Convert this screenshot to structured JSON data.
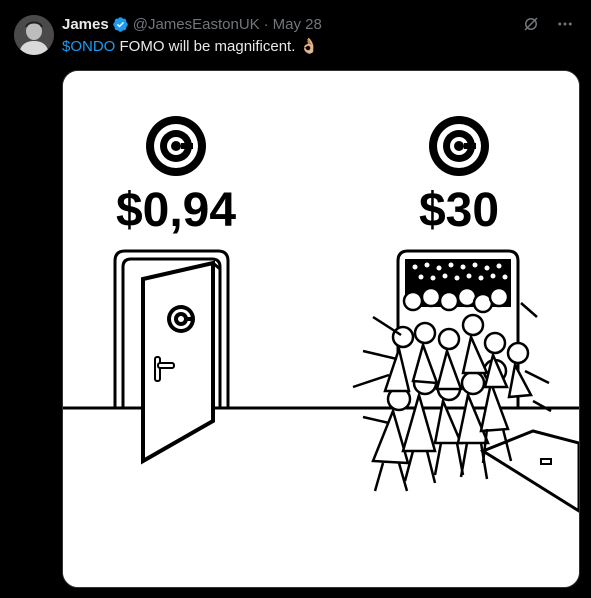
{
  "tweet": {
    "author_name": "James",
    "handle": "@JamesEastonUK",
    "separator": "·",
    "date": "May 28",
    "cashtag": "$ONDO",
    "text": " FOMO will be magnificent. ",
    "emoji": "👌🏼",
    "verified_icon": "verified-badge-icon",
    "icons": [
      "grok-icon",
      "more-icon"
    ]
  },
  "meme": {
    "left_price": "$0,94",
    "right_price": "$30",
    "logo_icon": "ondo-logo-icon"
  },
  "colors": {
    "background": "#000000",
    "text": "#e7e9ea",
    "muted": "#71767b",
    "link": "#1d9bf0"
  }
}
